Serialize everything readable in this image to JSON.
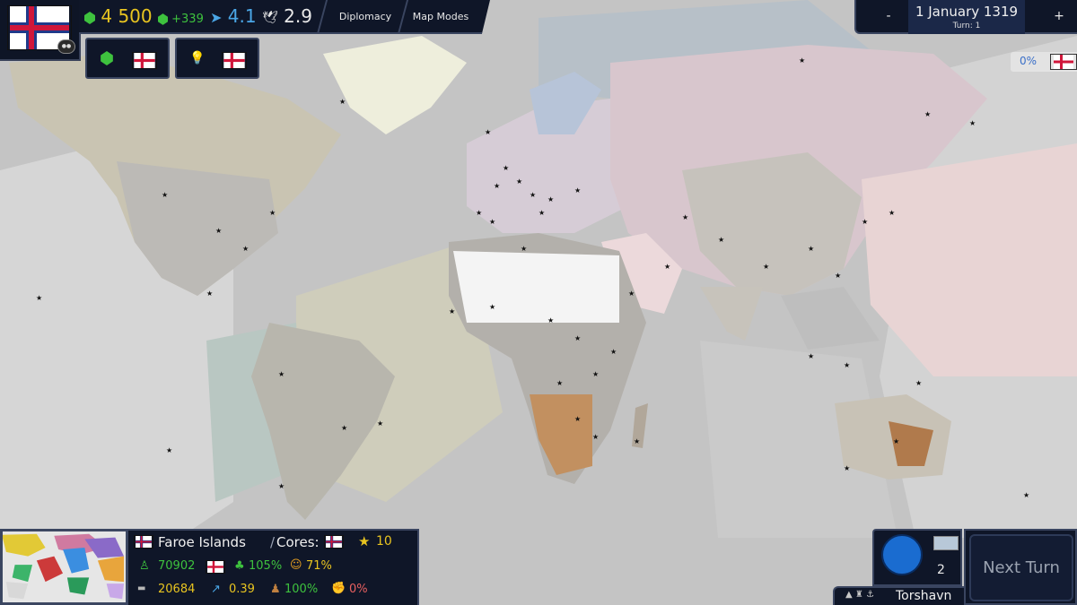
{
  "top_bar": {
    "gold": "4 500",
    "gold_income": "+339",
    "movement": "4.1",
    "diplomacy_points": "2.9",
    "diplomacy_button": "Diplomacy",
    "map_modes_button": "Map Modes"
  },
  "date_panel": {
    "minus": "-",
    "date": "1 January 1319",
    "turn": "Turn: 1",
    "plus": "+"
  },
  "relations_percent": "0%",
  "province_info": {
    "country": "Faroe Islands",
    "cores_label": "Cores:",
    "rank": "10",
    "population": "70902",
    "growth": "105%",
    "happiness": "71%",
    "economy": "20684",
    "tax": "0.39",
    "manpower": "100%",
    "revolution_risk": "0%"
  },
  "selected": {
    "unit_count": "2",
    "city_name": "Torshavn"
  },
  "next_turn_button": "Next Turn",
  "colors": {
    "panel": "#0f1628",
    "panel_border": "#3a4560",
    "gold": "#e8c420",
    "income": "#3ec23e",
    "movement": "#4aa6e6",
    "faroe_flag_red": "#d0163a",
    "faroe_flag_blue": "#1f3a8a"
  }
}
